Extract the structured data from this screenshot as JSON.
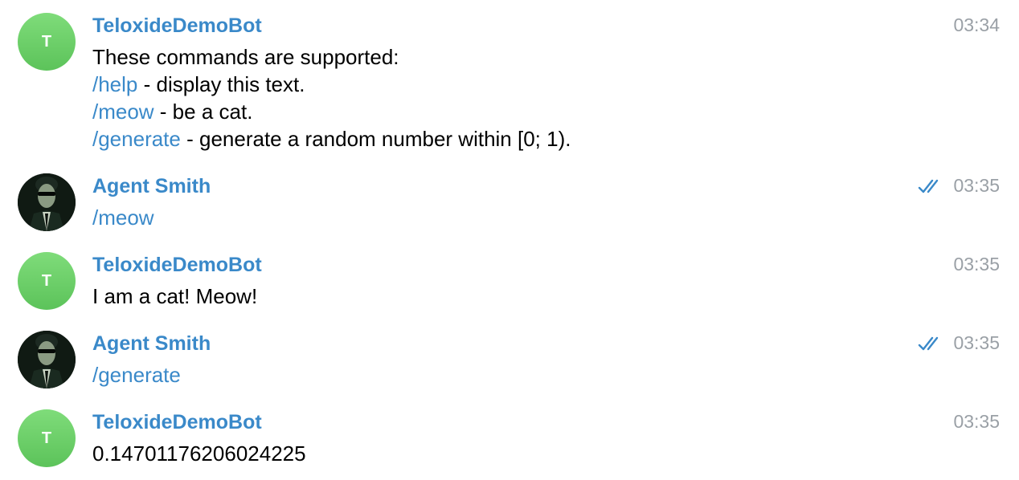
{
  "messages": [
    {
      "avatar_letter": "T",
      "sender": "TeloxideDemoBot",
      "time": "03:34",
      "lines": [
        {
          "cmd": "",
          "text": "These commands are supported:"
        },
        {
          "cmd": "/help",
          "text": " - display this text."
        },
        {
          "cmd": "/meow",
          "text": " - be a cat."
        },
        {
          "cmd": "/generate",
          "text": " - generate a random number within [0; 1)."
        }
      ]
    },
    {
      "sender": "Agent Smith",
      "time": "03:35",
      "read": true,
      "lines": [
        {
          "cmd": "/meow",
          "text": ""
        }
      ]
    },
    {
      "avatar_letter": "T",
      "sender": "TeloxideDemoBot",
      "time": "03:35",
      "lines": [
        {
          "cmd": "",
          "text": "I am a cat! Meow!"
        }
      ]
    },
    {
      "sender": "Agent Smith",
      "time": "03:35",
      "read": true,
      "lines": [
        {
          "cmd": "/generate",
          "text": ""
        }
      ]
    },
    {
      "avatar_letter": "T",
      "sender": "TeloxideDemoBot",
      "time": "03:35",
      "lines": [
        {
          "cmd": "",
          "text": "0.14701176206024225"
        }
      ]
    }
  ],
  "colors": {
    "link": "#3a89c9",
    "time": "#9aa0a6",
    "bot_avatar": "#6acd67"
  }
}
